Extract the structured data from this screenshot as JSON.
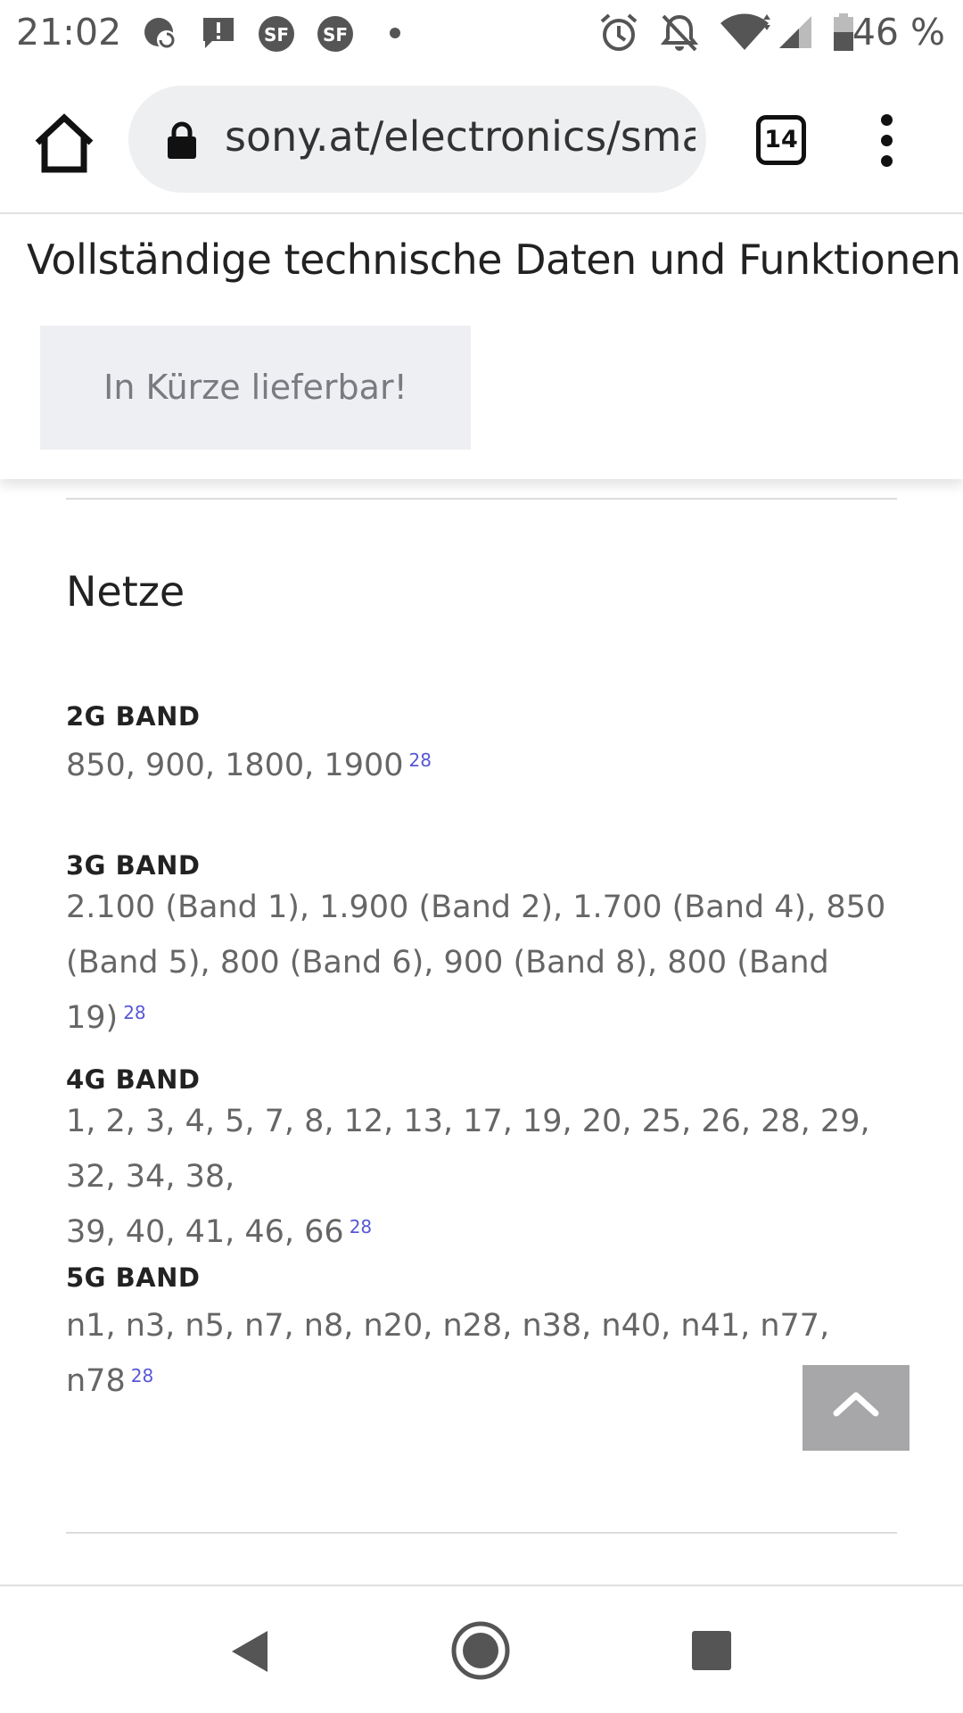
{
  "status_bar": {
    "time": "21:02",
    "battery": "46 %",
    "icons": [
      "sync-notification-icon",
      "alert-icon",
      "sf-app-icon",
      "sf-app-icon",
      "dot-icon",
      "alarm-icon",
      "notifications-off-icon",
      "wifi-icon",
      "signal-icon",
      "battery-icon"
    ]
  },
  "browser": {
    "url": "sony.at/electronics/sma",
    "tab_count": "14",
    "icons": [
      "home-icon",
      "lock-icon",
      "menu-icon"
    ]
  },
  "sticky": {
    "title": "Vollständige technische Daten und Funktionen",
    "availability": "In Kürze lieferbar!"
  },
  "section": {
    "title": "Netze",
    "specs": [
      {
        "label": "2G BAND",
        "value": "850, 900, 1800, 1900",
        "footnote": "28"
      },
      {
        "label": "3G BAND",
        "value_line1": "2.100 (Band 1), 1.900 (Band 2), 1.700 (Band 4), 850",
        "value_line2": "(Band 5), 800 (Band 6), 900 (Band 8), 800 (Band 19)",
        "footnote": "28"
      },
      {
        "label": "4G BAND",
        "value_line1": "1, 2, 3, 4, 5, 7, 8, 12, 13, 17, 19, 20, 25, 26, 28, 29, 32, 34, 38,",
        "value_line2": "39, 40, 41, 46, 66",
        "footnote": "28"
      },
      {
        "label": "5G BAND",
        "value": "n1, n3, n5, n7, n8, n20, n28, n38, n40, n41, n77, n78",
        "footnote": "28"
      }
    ]
  },
  "colors": {
    "footnote": "#5757d6",
    "back_to_top": "#a7a7aa",
    "availability_bg": "#eeeff2",
    "url_bg": "#eeeff1"
  },
  "nav": {
    "icons": [
      "back-icon",
      "home-circle-icon",
      "recents-icon"
    ]
  }
}
